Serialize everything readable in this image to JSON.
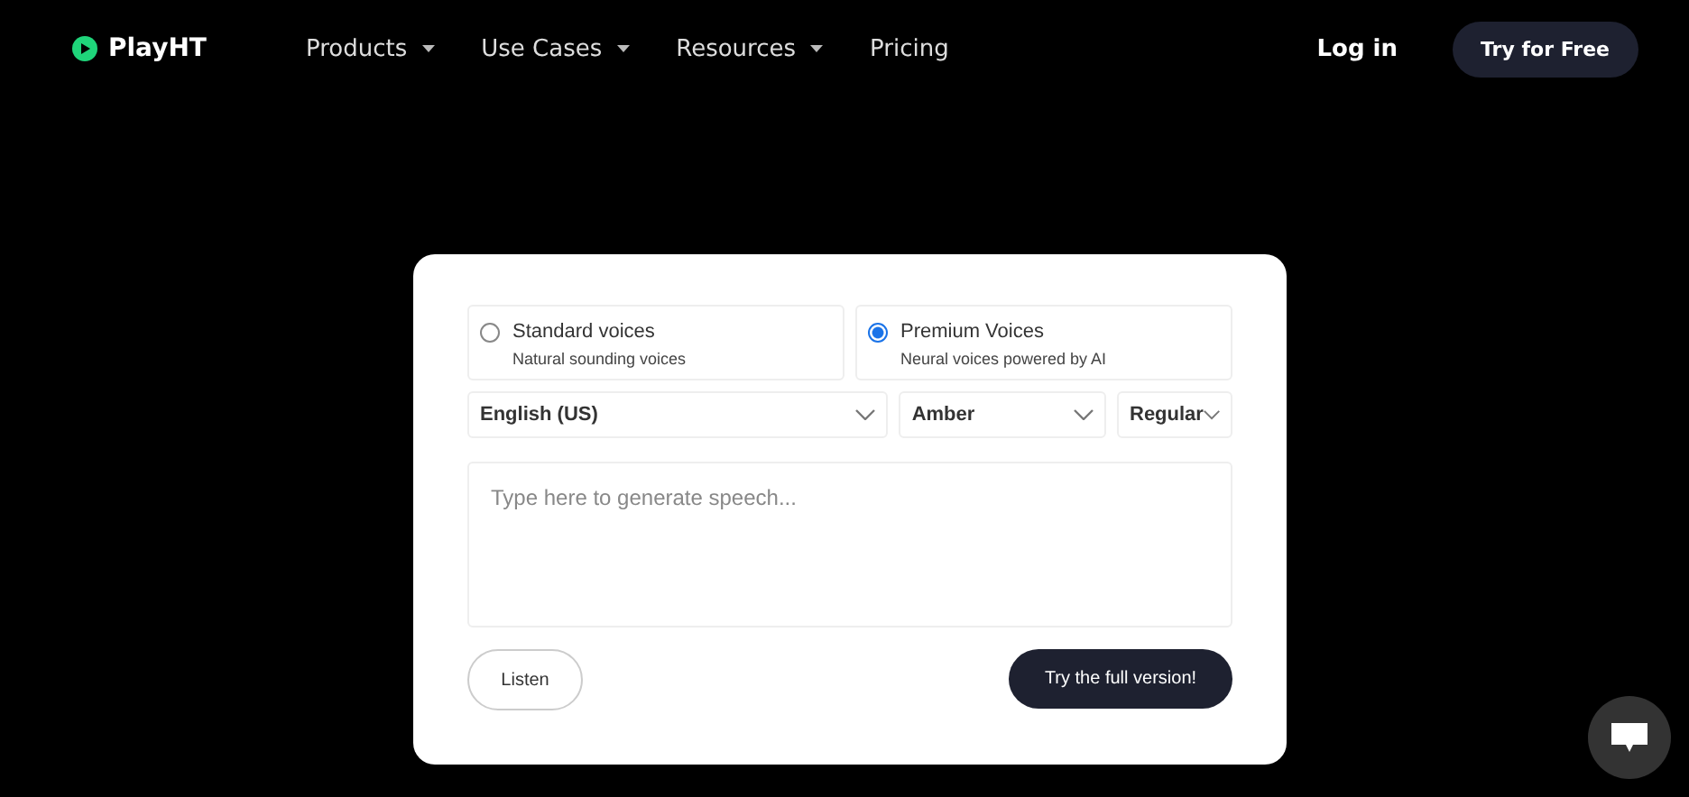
{
  "nav": {
    "logo": "PlayHT",
    "menu": [
      {
        "label": "Products",
        "dropdown": true
      },
      {
        "label": "Use Cases",
        "dropdown": true
      },
      {
        "label": "Resources",
        "dropdown": true
      },
      {
        "label": "Pricing",
        "dropdown": false
      }
    ],
    "login": "Log in",
    "cta": "Try for Free"
  },
  "demo": {
    "voice_types": [
      {
        "title": "Standard voices",
        "subtitle": "Natural sounding voices",
        "selected": false
      },
      {
        "title": "Premium Voices",
        "subtitle": "Neural voices powered by AI",
        "selected": true
      }
    ],
    "selects": [
      {
        "value": "English (US)"
      },
      {
        "value": "Amber"
      },
      {
        "value": "Regular"
      }
    ],
    "text": {
      "placeholder": "Type here to generate speech..."
    },
    "listen": "Listen",
    "full_version": "Try the full version!"
  }
}
